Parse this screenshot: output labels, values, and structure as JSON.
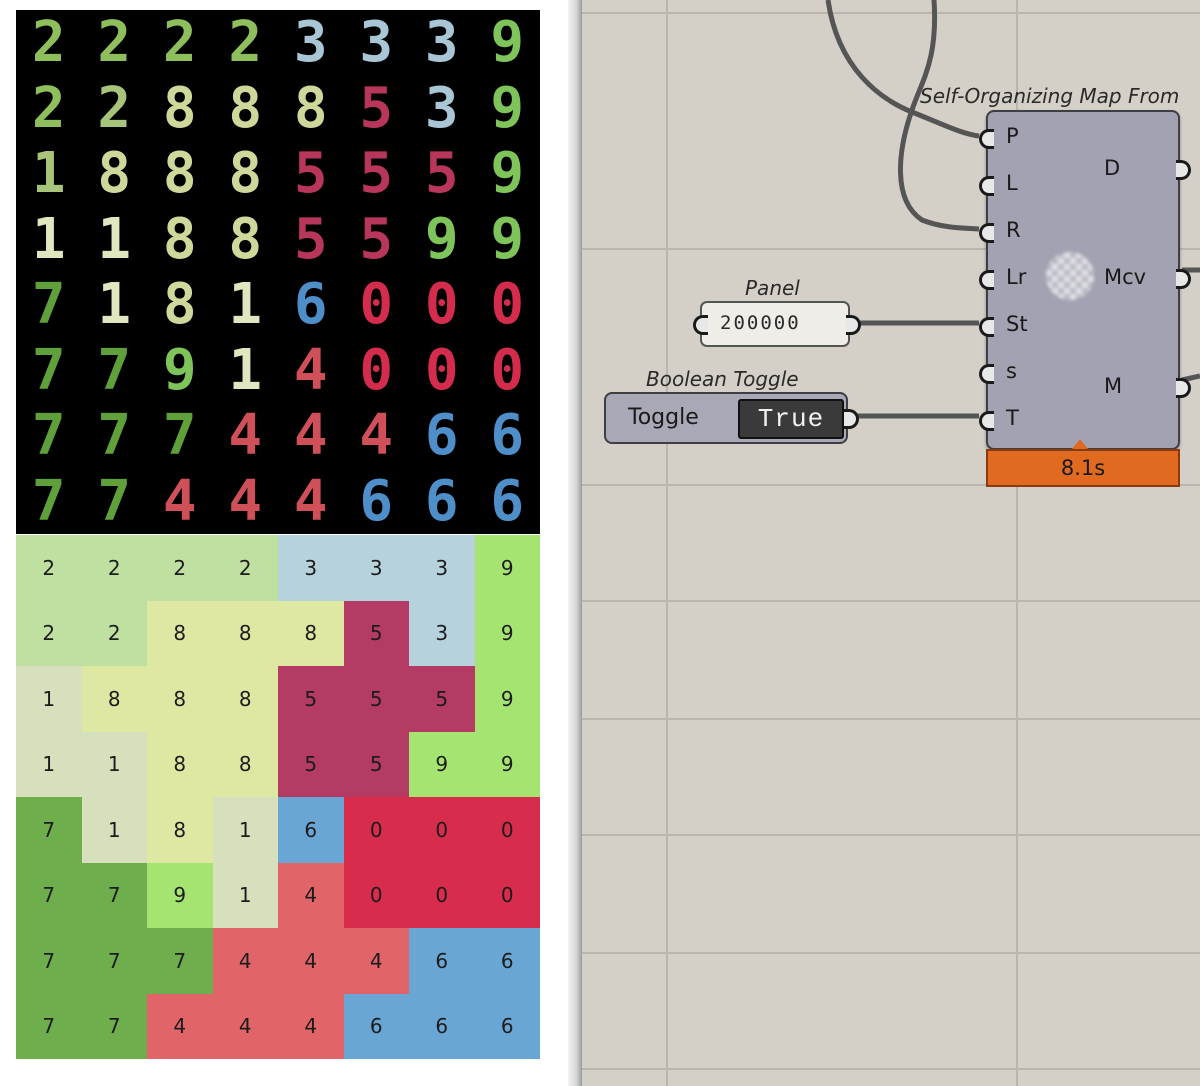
{
  "digit_strip": {
    "columns": [
      [
        {
          "d": "2",
          "c": "#8fbf5c"
        },
        {
          "d": "2",
          "c": "#8fbf5c"
        },
        {
          "d": "1",
          "c": "#a8c47a"
        },
        {
          "d": "1",
          "c": "#dfe6c0"
        },
        {
          "d": "7",
          "c": "#5fa03a"
        },
        {
          "d": "7",
          "c": "#5fa03a"
        },
        {
          "d": "7",
          "c": "#5fa03a"
        },
        {
          "d": "7",
          "c": "#5fa03a"
        }
      ],
      [
        {
          "d": "2",
          "c": "#8fbf5c"
        },
        {
          "d": "2",
          "c": "#a8c47a"
        },
        {
          "d": "8",
          "c": "#cfd89a"
        },
        {
          "d": "1",
          "c": "#dfe6c0"
        },
        {
          "d": "1",
          "c": "#dfe6c0"
        },
        {
          "d": "7",
          "c": "#5fa03a"
        },
        {
          "d": "7",
          "c": "#5fa03a"
        },
        {
          "d": "7",
          "c": "#5fa03a"
        }
      ],
      [
        {
          "d": "2",
          "c": "#8fbf5c"
        },
        {
          "d": "8",
          "c": "#cfd89a"
        },
        {
          "d": "8",
          "c": "#cfd89a"
        },
        {
          "d": "8",
          "c": "#cfd89a"
        },
        {
          "d": "8",
          "c": "#cfd89a"
        },
        {
          "d": "9",
          "c": "#7fc45a"
        },
        {
          "d": "7",
          "c": "#5fa03a"
        },
        {
          "d": "4",
          "c": "#d0505a"
        }
      ],
      [
        {
          "d": "2",
          "c": "#8fbf5c"
        },
        {
          "d": "8",
          "c": "#cfd89a"
        },
        {
          "d": "8",
          "c": "#cfd89a"
        },
        {
          "d": "8",
          "c": "#cfd89a"
        },
        {
          "d": "1",
          "c": "#dfe6c0"
        },
        {
          "d": "1",
          "c": "#dfe6c0"
        },
        {
          "d": "4",
          "c": "#d0505a"
        },
        {
          "d": "4",
          "c": "#d0505a"
        }
      ],
      [
        {
          "d": "3",
          "c": "#a9c6d6"
        },
        {
          "d": "8",
          "c": "#cfd89a"
        },
        {
          "d": "5",
          "c": "#b8365a"
        },
        {
          "d": "5",
          "c": "#b8365a"
        },
        {
          "d": "6",
          "c": "#4f8fc9"
        },
        {
          "d": "4",
          "c": "#d0505a"
        },
        {
          "d": "4",
          "c": "#d0505a"
        },
        {
          "d": "4",
          "c": "#d0505a"
        }
      ],
      [
        {
          "d": "3",
          "c": "#a9c6d6"
        },
        {
          "d": "5",
          "c": "#b8365a"
        },
        {
          "d": "5",
          "c": "#b8365a"
        },
        {
          "d": "5",
          "c": "#b8365a"
        },
        {
          "d": "0",
          "c": "#d42c4c"
        },
        {
          "d": "0",
          "c": "#d42c4c"
        },
        {
          "d": "4",
          "c": "#d0505a"
        },
        {
          "d": "6",
          "c": "#4f8fc9"
        }
      ],
      [
        {
          "d": "3",
          "c": "#a9c6d6"
        },
        {
          "d": "3",
          "c": "#a9c6d6"
        },
        {
          "d": "5",
          "c": "#b8365a"
        },
        {
          "d": "9",
          "c": "#7fc45a"
        },
        {
          "d": "0",
          "c": "#d42c4c"
        },
        {
          "d": "0",
          "c": "#d42c4c"
        },
        {
          "d": "6",
          "c": "#4f8fc9"
        },
        {
          "d": "6",
          "c": "#4f8fc9"
        }
      ],
      [
        {
          "d": "9",
          "c": "#7fc45a"
        },
        {
          "d": "9",
          "c": "#7fc45a"
        },
        {
          "d": "9",
          "c": "#7fc45a"
        },
        {
          "d": "9",
          "c": "#7fc45a"
        },
        {
          "d": "0",
          "c": "#d42c4c"
        },
        {
          "d": "0",
          "c": "#d42c4c"
        },
        {
          "d": "6",
          "c": "#4f8fc9"
        },
        {
          "d": "6",
          "c": "#4f8fc9"
        }
      ]
    ]
  },
  "som_grid": {
    "palette": {
      "0": "#d82c4c",
      "1": "#d6e0bc",
      "2": "#bfe0a0",
      "3": "#b6d2dc",
      "4": "#e06468",
      "5": "#b43c64",
      "6": "#6aa6d4",
      "7": "#6fae4c",
      "8": "#dfe8a2",
      "9": "#a6e472"
    },
    "rows": [
      [
        "2",
        "2",
        "2",
        "2",
        "3",
        "3",
        "3",
        "9"
      ],
      [
        "2",
        "2",
        "8",
        "8",
        "8",
        "5",
        "3",
        "9"
      ],
      [
        "1",
        "8",
        "8",
        "8",
        "5",
        "5",
        "5",
        "9"
      ],
      [
        "1",
        "1",
        "8",
        "8",
        "5",
        "5",
        "9",
        "9"
      ],
      [
        "7",
        "1",
        "8",
        "1",
        "6",
        "0",
        "0",
        "0"
      ],
      [
        "7",
        "7",
        "9",
        "1",
        "4",
        "0",
        "0",
        "0"
      ],
      [
        "7",
        "7",
        "7",
        "4",
        "4",
        "4",
        "6",
        "6"
      ],
      [
        "7",
        "7",
        "4",
        "4",
        "4",
        "6",
        "6",
        "6"
      ]
    ]
  },
  "canvas": {
    "som_component": {
      "title": "Self-Organizing Map From",
      "inputs": [
        "P",
        "L",
        "R",
        "Lr",
        "St",
        "s",
        "T"
      ],
      "outputs": [
        "D",
        "Mcv",
        "M"
      ],
      "timing": "8.1s"
    },
    "panel": {
      "title": "Panel",
      "value": "200000"
    },
    "toggle": {
      "title": "Boolean Toggle",
      "label": "Toggle",
      "value": "True"
    }
  }
}
